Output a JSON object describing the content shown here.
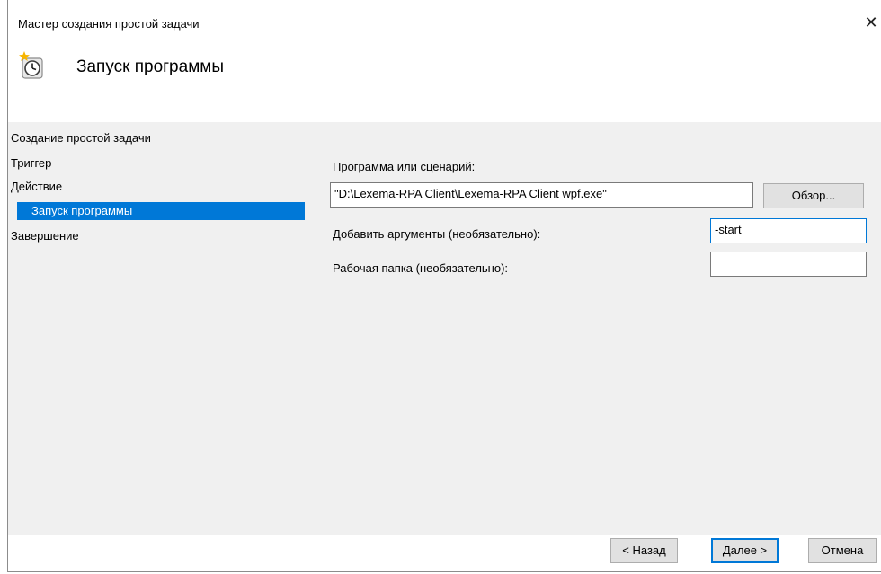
{
  "window": {
    "title": "Мастер создания простой задачи",
    "close_glyph": "✕"
  },
  "header": {
    "icon": "scheduled-task-clock-icon",
    "title": "Запуск программы"
  },
  "steps": [
    {
      "label": "Создание простой задачи"
    },
    {
      "label": "Триггер"
    },
    {
      "label": "Действие"
    },
    {
      "label": "Запуск программы",
      "selected": true
    },
    {
      "label": "Завершение"
    }
  ],
  "form": {
    "program_label": "Программа или сценарий:",
    "program_value": "\"D:\\Lexema-RPA Client\\Lexema-RPA Client wpf.exe\"",
    "browse_label": "Обзор...",
    "args_label": "Добавить аргументы (необязательно):",
    "args_value": "-start",
    "workdir_label": "Рабочая папка (необязательно):",
    "workdir_value": ""
  },
  "buttons": {
    "back": "< Назад",
    "next": "Далее >",
    "cancel": "Отмена"
  },
  "colors": {
    "selection": "#0078d7",
    "panel_bg": "#f0f0f0"
  }
}
